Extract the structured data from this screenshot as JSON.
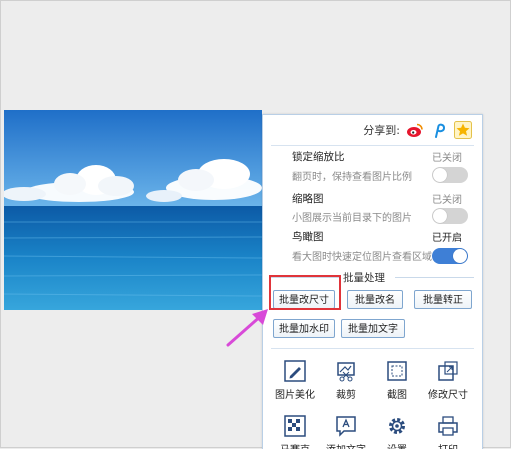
{
  "share": {
    "label": "分享到:"
  },
  "options": [
    {
      "title": "锁定缩放比",
      "state": "已关闭",
      "desc": "翻页时，保持查看图片比例",
      "toggle_on": false
    },
    {
      "title": "缩略图",
      "state": "已关闭",
      "desc": "小图展示当前目录下的图片",
      "toggle_on": false
    },
    {
      "title": "鸟瞰图",
      "state": "已开启",
      "desc": "看大图时快速定位图片查看区域",
      "toggle_on": true
    }
  ],
  "batch": {
    "title": "批量处理",
    "buttons": [
      "批量改尺寸",
      "批量改名",
      "批量转正",
      "批量加水印",
      "批量加文字"
    ]
  },
  "tools": [
    {
      "label": "图片美化",
      "icon": "pencil-icon"
    },
    {
      "label": "裁剪",
      "icon": "crop-icon"
    },
    {
      "label": "截图",
      "icon": "screenshot-icon"
    },
    {
      "label": "修改尺寸",
      "icon": "resize-icon"
    },
    {
      "label": "马赛克",
      "icon": "mosaic-icon"
    },
    {
      "label": "添加文字",
      "icon": "add-text-icon"
    },
    {
      "label": "设置",
      "icon": "gear-icon"
    },
    {
      "label": "打印",
      "icon": "print-icon"
    }
  ],
  "colors": {
    "accent": "#3e7fd6",
    "highlight": "#e0343a",
    "arrow": "#d84ad8",
    "border": "#b9cfe6"
  }
}
